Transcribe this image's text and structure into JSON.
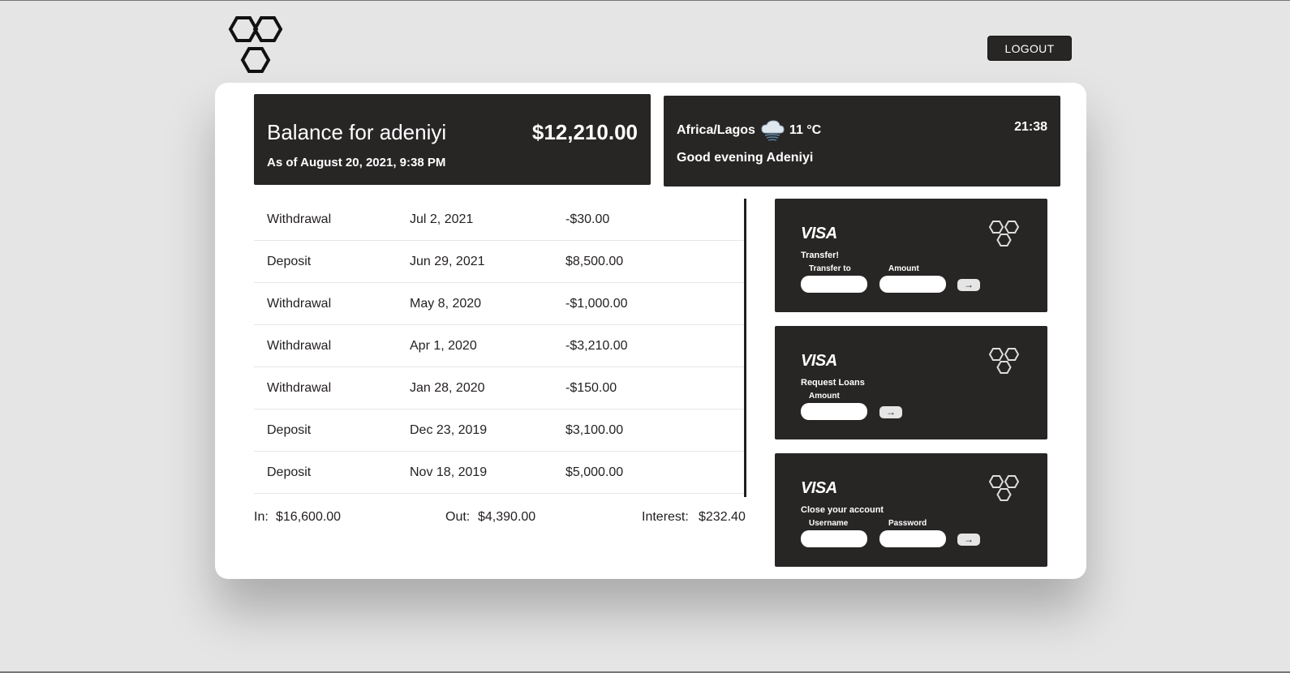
{
  "header": {
    "logout_label": "LOGOUT"
  },
  "balance": {
    "title": "Balance for adeniyi",
    "as_of": "As of August 20, 2021, 9:38 PM",
    "amount": "$12,210.00"
  },
  "weather": {
    "location": "Africa/Lagos",
    "icon": "cloud-snow-icon",
    "temperature": "11 °C",
    "time": "21:38",
    "greeting": "Good evening Adeniyi"
  },
  "movements": [
    {
      "type": "Withdrawal",
      "date": "Jul 2, 2021",
      "value": "-$30.00"
    },
    {
      "type": "Deposit",
      "date": "Jun 29, 2021",
      "value": "$8,500.00"
    },
    {
      "type": "Withdrawal",
      "date": "May 8, 2020",
      "value": "-$1,000.00"
    },
    {
      "type": "Withdrawal",
      "date": "Apr 1, 2020",
      "value": "-$3,210.00"
    },
    {
      "type": "Withdrawal",
      "date": "Jan 28, 2020",
      "value": "-$150.00"
    },
    {
      "type": "Deposit",
      "date": "Dec 23, 2019",
      "value": "$3,100.00"
    },
    {
      "type": "Deposit",
      "date": "Nov 18, 2019",
      "value": "$5,000.00"
    }
  ],
  "summary": {
    "in_label": "In:",
    "in_value": "$16,600.00",
    "out_label": "Out:",
    "out_value": "$4,390.00",
    "interest_label": "Interest:",
    "interest_value": "$232.40"
  },
  "operations": {
    "transfer": {
      "brand": "VISA",
      "title": "Transfer!",
      "label_to": "Transfer to",
      "label_amount": "Amount",
      "button": "→"
    },
    "loan": {
      "brand": "VISA",
      "title": "Request Loans",
      "label_amount": "Amount",
      "button": "→"
    },
    "close": {
      "brand": "VISA",
      "title": "Close your account",
      "label_user": "Username",
      "label_pin": "Password",
      "button": "→"
    }
  },
  "colors": {
    "background": "#e5e5e5",
    "dark": "#282525",
    "card": "#ffffff"
  }
}
